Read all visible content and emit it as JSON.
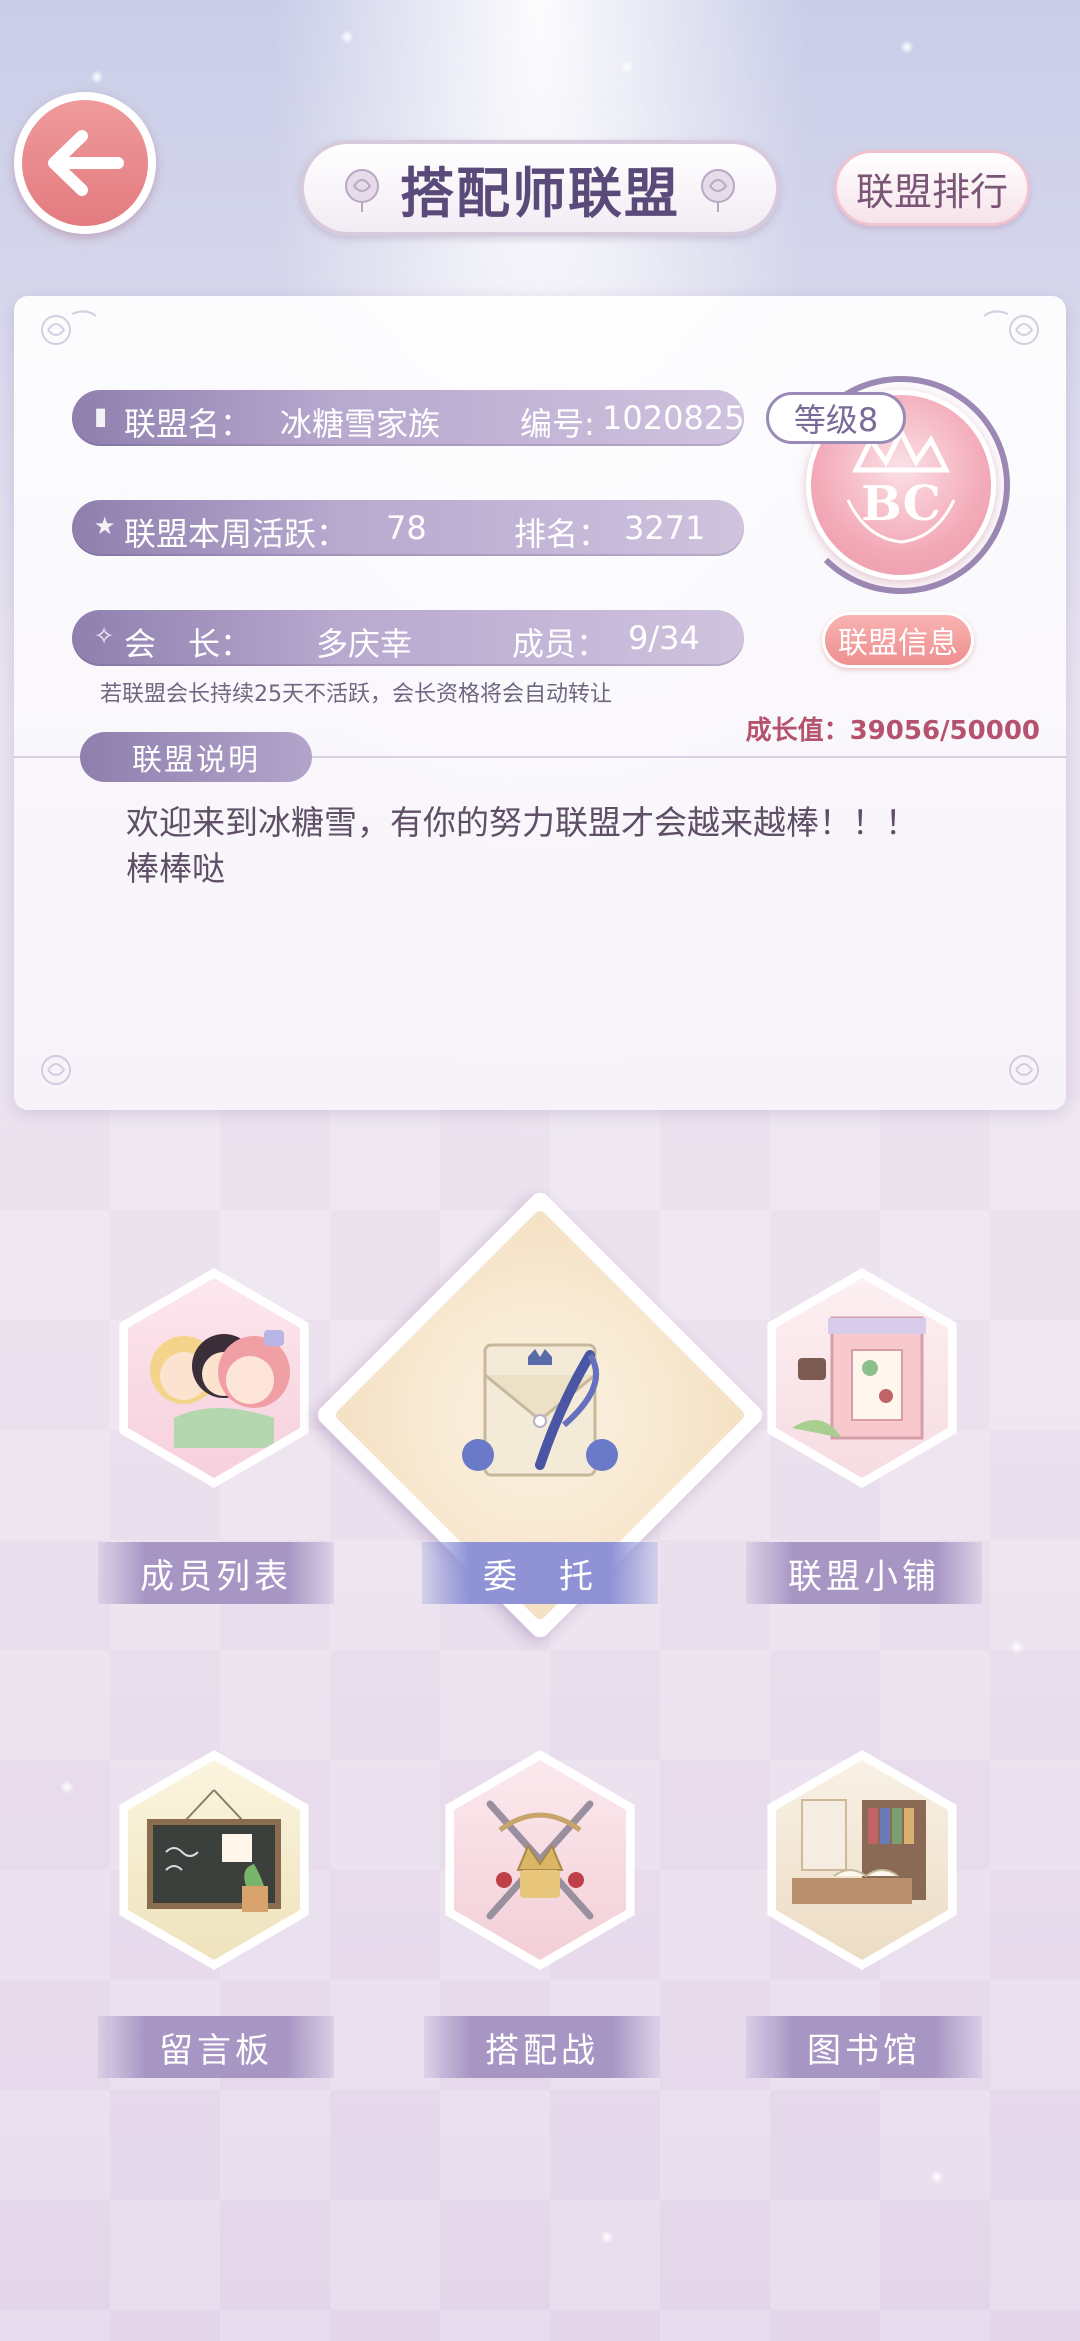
{
  "header": {
    "title": "搭配师联盟",
    "rank_button": "联盟排行"
  },
  "alliance": {
    "name_label": "联盟名：",
    "name": "冰糖雪家族",
    "id_label": "编号:",
    "id": "1020825",
    "activity_label": "联盟本周活跃：",
    "activity": "78",
    "rank_label": "排名：",
    "rank": "3271",
    "leader_label": "会　长：",
    "leader": "多庆幸",
    "members_label": "成员：",
    "members": "9/34",
    "level": "等级8",
    "info_button": "联盟信息",
    "notice": "若联盟会长持续25天不活跃，会长资格将会自动转让",
    "growth": "成长值：39056/50000"
  },
  "description": {
    "label": "联盟说明",
    "text": "欢迎来到冰糖雪，有你的努力联盟才会越来越棒！！！\n棒棒哒"
  },
  "features": [
    {
      "label": "成员列表"
    },
    {
      "label": "委　托"
    },
    {
      "label": "联盟小铺"
    },
    {
      "label": "留言板"
    },
    {
      "label": "搭配战"
    },
    {
      "label": "图书馆"
    }
  ],
  "colors": {
    "accent_purple": "#8e7fae",
    "back_button": "#e37b7f",
    "growth_text": "#b5536f"
  }
}
